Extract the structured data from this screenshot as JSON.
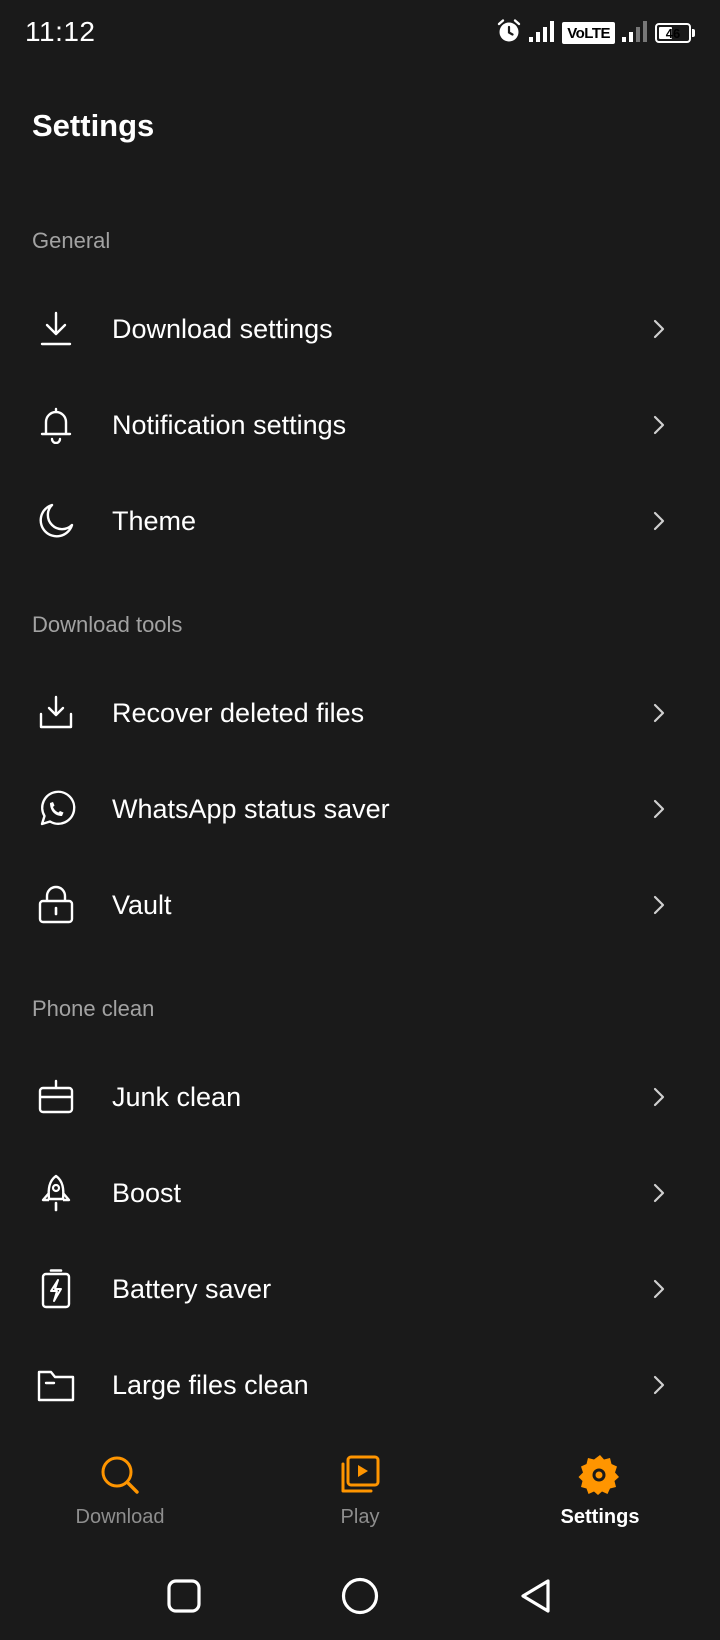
{
  "status_bar": {
    "time": "11:12",
    "network_badge": "VoLTE",
    "battery_level": "46",
    "battery_fraction": 0.46
  },
  "header": {
    "title": "Settings"
  },
  "sections": [
    {
      "title": "General",
      "items": [
        {
          "label": "Download settings",
          "icon": "download-icon"
        },
        {
          "label": "Notification settings",
          "icon": "bell-icon"
        },
        {
          "label": "Theme",
          "icon": "moon-icon"
        }
      ]
    },
    {
      "title": "Download tools",
      "items": [
        {
          "label": "Recover deleted files",
          "icon": "tray-download-icon"
        },
        {
          "label": "WhatsApp status saver",
          "icon": "whatsapp-icon"
        },
        {
          "label": "Vault",
          "icon": "lock-icon"
        }
      ]
    },
    {
      "title": "Phone clean",
      "items": [
        {
          "label": "Junk clean",
          "icon": "basket-icon"
        },
        {
          "label": "Boost",
          "icon": "rocket-icon"
        },
        {
          "label": "Battery saver",
          "icon": "battery-bolt-icon"
        },
        {
          "label": "Large files clean",
          "icon": "folder-icon"
        }
      ]
    }
  ],
  "bottom_nav": {
    "items": [
      {
        "label": "Download",
        "icon": "search-icon",
        "active": false
      },
      {
        "label": "Play",
        "icon": "play-library-icon",
        "active": false
      },
      {
        "label": "Settings",
        "icon": "gear-icon",
        "active": true
      }
    ]
  },
  "colors": {
    "background": "#1a1a1a",
    "accent": "#ff9500",
    "section_header": "#a2a2a2",
    "text": "#ffffff"
  }
}
